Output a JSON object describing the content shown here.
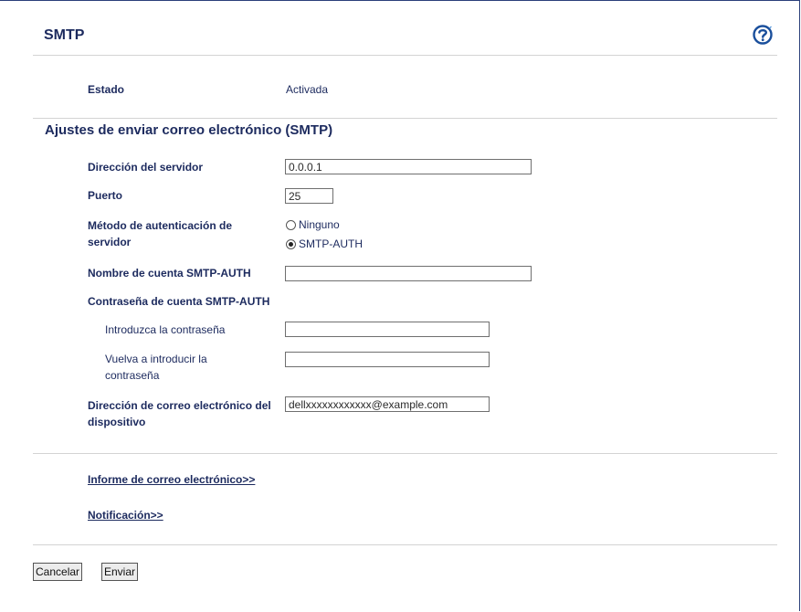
{
  "header": {
    "title": "SMTP",
    "help_icon": "help-question-icon"
  },
  "status": {
    "label": "Estado",
    "value": "Activada"
  },
  "section": {
    "title": "Ajustes de enviar correo electrónico (SMTP)"
  },
  "fields": {
    "server_address": {
      "label": "Dirección del servidor",
      "value": "0.0.0.1"
    },
    "port": {
      "label": "Puerto",
      "value": "25"
    },
    "auth_method": {
      "label": "Método de autenticación de servidor",
      "options": [
        "Ninguno",
        "SMTP-AUTH"
      ],
      "selected": "SMTP-AUTH"
    },
    "account_name": {
      "label": "Nombre de cuenta SMTP-AUTH",
      "value": ""
    },
    "password_group": {
      "label": "Contraseña de cuenta SMTP-AUTH"
    },
    "password": {
      "label": "Introduzca la contraseña",
      "value": ""
    },
    "password_confirm": {
      "label": "Vuelva a introducir la contraseña",
      "value": ""
    },
    "device_email": {
      "label": "Dirección de correo electrónico del dispositivo",
      "value": "dellxxxxxxxxxxxx@example.com"
    }
  },
  "links": {
    "email_report": "Informe de correo electrónico>>",
    "notification": "Notificación>>"
  },
  "buttons": {
    "cancel": "Cancelar",
    "submit": "Enviar"
  },
  "colors": {
    "text": "#1c2a5e",
    "border": "#2b3f7a",
    "help_icon": "#1a4f9c"
  }
}
